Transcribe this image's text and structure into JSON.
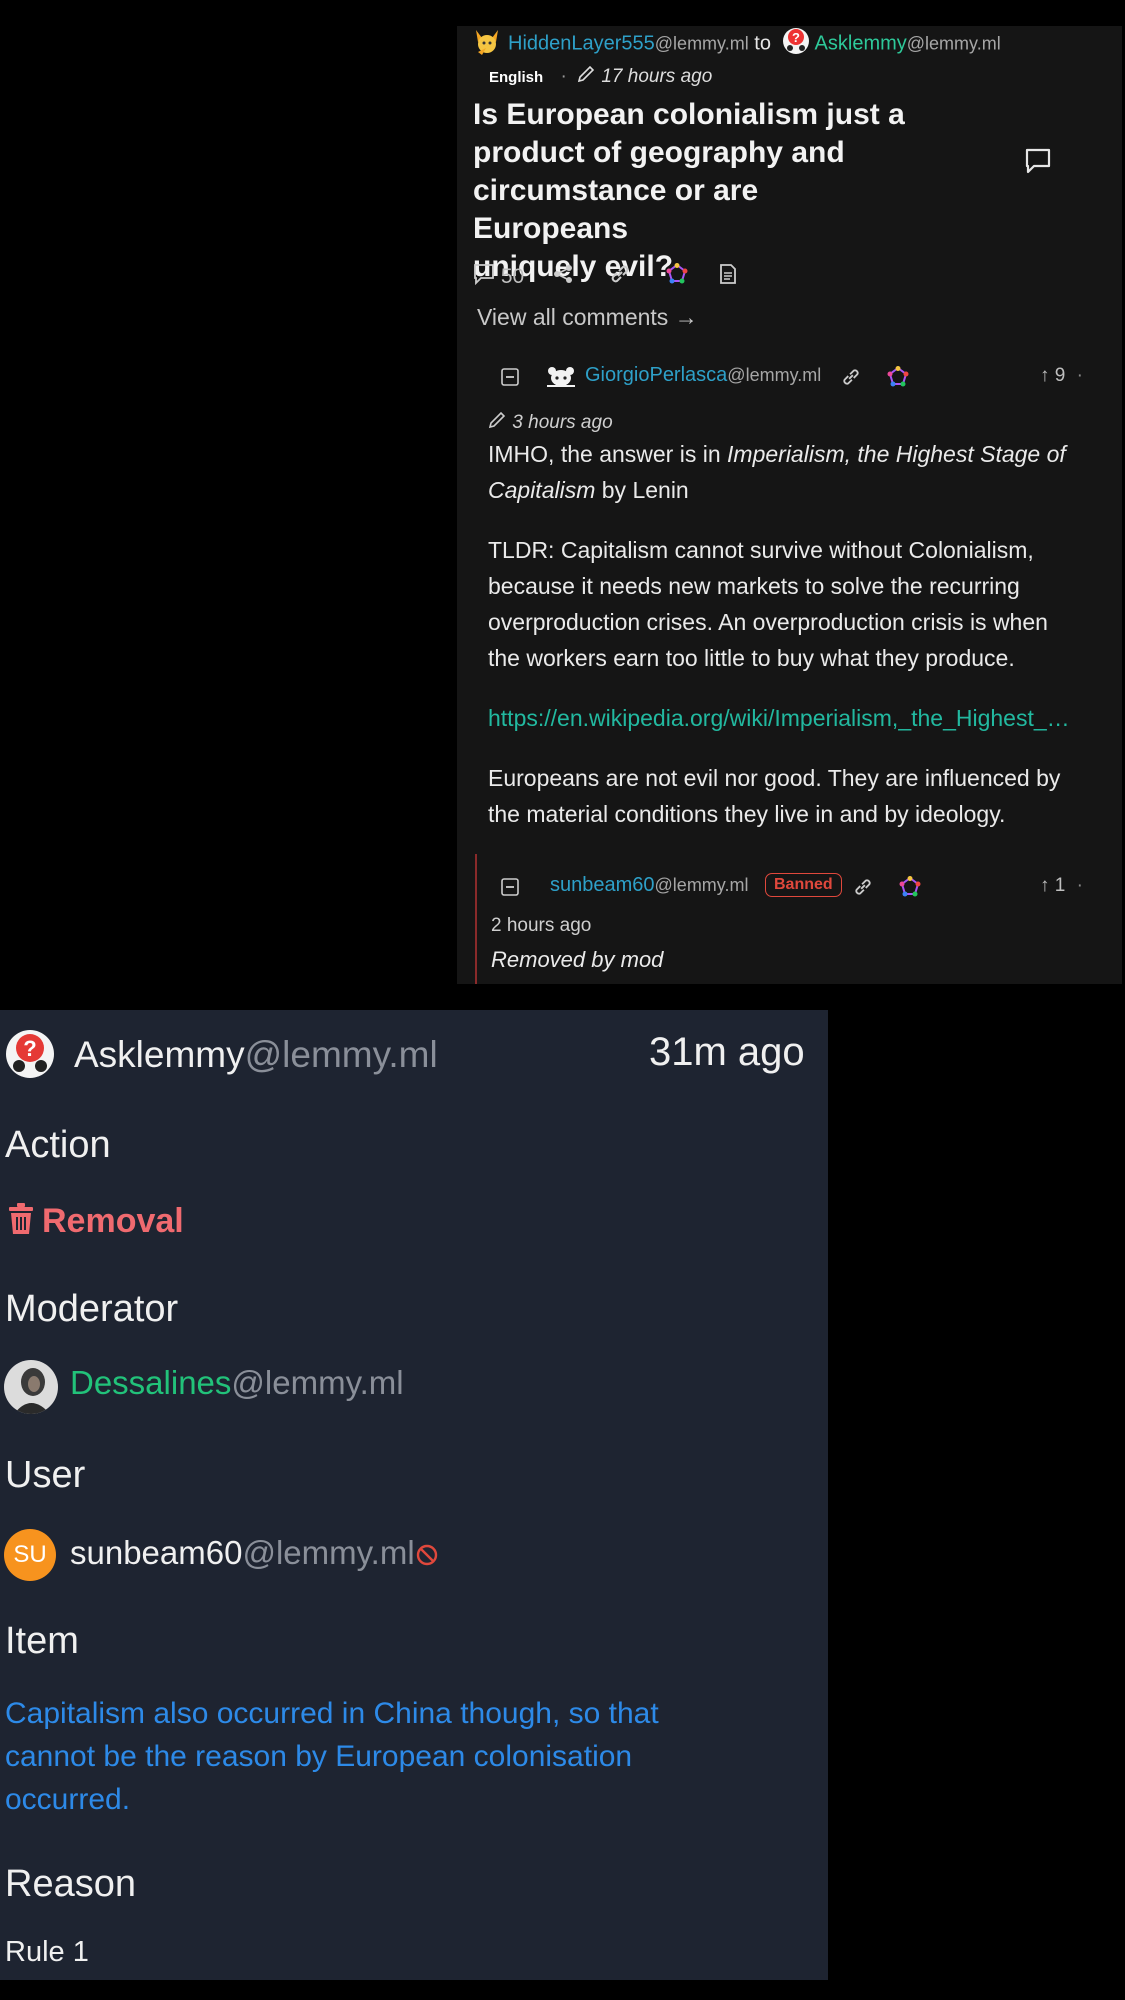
{
  "post": {
    "author": "HiddenLayer555",
    "author_instance": "@lemmy.ml",
    "to_word": "to",
    "community": "Asklemmy",
    "community_instance": "@lemmy.ml",
    "language": "English",
    "time": "17 hours ago",
    "title": "Is European colonialism just a product of geography and circumstance or are Europeans uniquely evil?",
    "title_lines": [
      "Is European colonialism just a",
      "product of geography and",
      "circumstance or are Europeans",
      "uniquely evil?"
    ],
    "comment_count": "50",
    "view_all": "View all comments →"
  },
  "comment": {
    "author": "GiorgioPerlasca",
    "author_instance": "@lemmy.ml",
    "score": "9",
    "time": "3 hours ago",
    "p1_a": "IMHO, the answer is in ",
    "p1_italic": "Imperialism, the Highest Stage of",
    "p1_italic2": "Capitalism",
    "p1_b": " by Lenin",
    "p2_lines": [
      "TLDR: Capitalism cannot survive without Colonialism,",
      "because it needs new markets to solve the recurring",
      "overproduction crises. An overproduction crisis is when",
      "the workers earn too little to buy what they produce."
    ],
    "link": "https://en.wikipedia.org/wiki/Imperialism,_the_Highest_…",
    "p3_lines": [
      "Europeans are not evil nor good. They are influenced by",
      "the material conditions they live in and by ideology."
    ]
  },
  "reply": {
    "author": "sunbeam60",
    "author_instance": "@lemmy.ml",
    "badge": "Banned",
    "score": "1",
    "time": "2 hours ago",
    "body": "Removed by mod"
  },
  "modlog": {
    "community": "Asklemmy",
    "community_instance": "@lemmy.ml",
    "time": "31m ago",
    "action_label": "Action",
    "action_value": "Removal",
    "moderator_label": "Moderator",
    "moderator": "Dessalines",
    "moderator_instance": "@lemmy.ml",
    "user_label": "User",
    "user_initials": "SU",
    "user": "sunbeam60",
    "user_instance": "@lemmy.ml",
    "item_label": "Item",
    "item_lines": [
      "Capitalism also occurred in China though, so that",
      "cannot be the reason by European colonisation",
      "occurred."
    ],
    "reason_label": "Reason",
    "reason_value": "Rule 1"
  },
  "colors": {
    "username_blue": "#2ea0c8",
    "community_teal": "#2ec99a",
    "banned_red": "#e0483c",
    "removal_red": "#f06a6f",
    "moderator_green": "#22c27a",
    "item_blue": "#2d8ae8",
    "avatar_orange": "#f7931e"
  }
}
